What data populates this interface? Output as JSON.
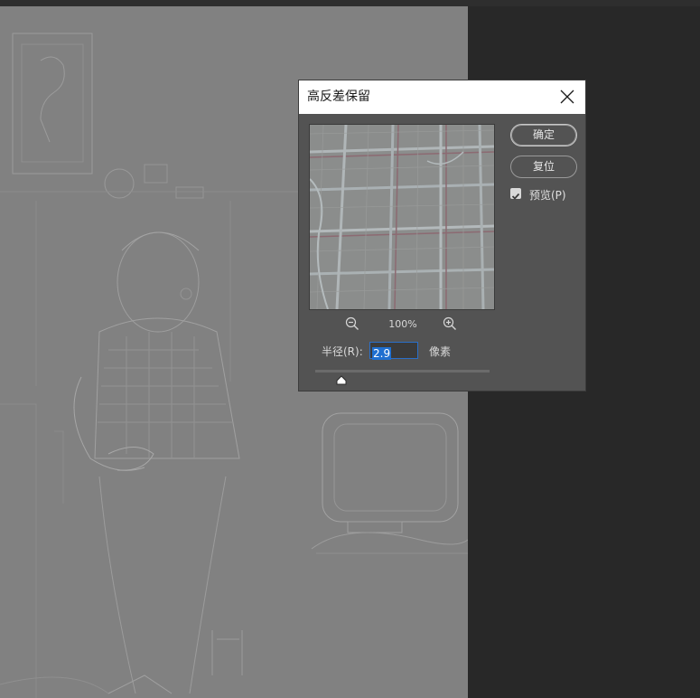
{
  "dialog": {
    "title": "高反差保留",
    "ok_label": "确定",
    "reset_label": "复位",
    "preview_label": "预览(P)",
    "preview_checked": true,
    "zoom_level": "100%",
    "radius_label": "半径(R):",
    "radius_value": "2.9",
    "radius_unit": "像素",
    "slider_fraction": 0.15
  },
  "icons": {
    "close": "close-icon",
    "zoom_out": "zoom-out-icon",
    "zoom_in": "zoom-in-icon",
    "check": "check-icon"
  },
  "colors": {
    "workspace": "#282828",
    "document": "#818181",
    "dialog_bg": "#535353",
    "selection": "#1f6fd0"
  }
}
